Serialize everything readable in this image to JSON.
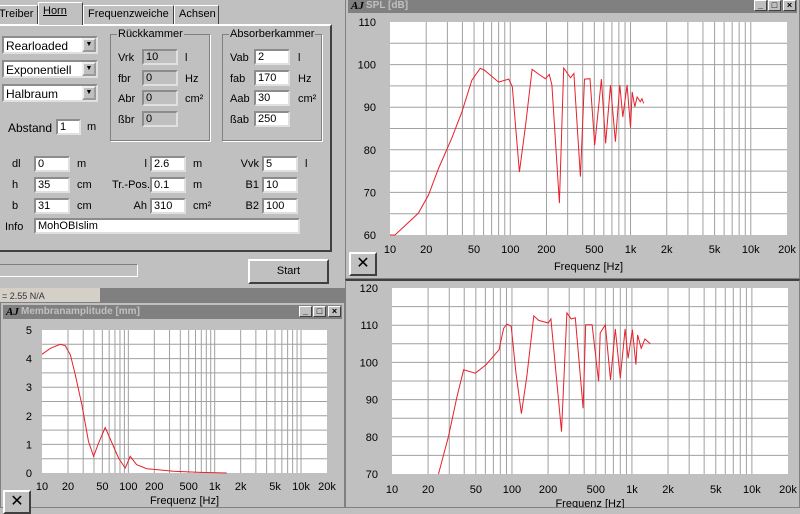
{
  "tabs": [
    "Treiber",
    "Horn",
    "Frequenzweiche",
    "Achsen"
  ],
  "combos": [
    "Rearloaded",
    "Exponentiell",
    "Halbraum"
  ],
  "abstand": {
    "label": "Abstand",
    "value": "1",
    "unit": "m"
  },
  "rueckkammer": {
    "title": "Rückkammer",
    "rows": [
      {
        "label": "Vrk",
        "value": "10",
        "unit": "l"
      },
      {
        "label": "fbr",
        "value": "0",
        "unit": "Hz"
      },
      {
        "label": "Abr",
        "value": "0",
        "unit": "cm²"
      },
      {
        "label": "ßbr",
        "value": "0",
        "unit": ""
      }
    ]
  },
  "absorberkammer": {
    "title": "Absorberkammer",
    "rows": [
      {
        "label": "Vab",
        "value": "2",
        "unit": "l"
      },
      {
        "label": "fab",
        "value": "170",
        "unit": "Hz"
      },
      {
        "label": "Aab",
        "value": "30",
        "unit": "cm²"
      },
      {
        "label": "ßab",
        "value": "250",
        "unit": ""
      }
    ]
  },
  "horn_params": [
    [
      {
        "label": "dl",
        "value": "0",
        "unit": "m"
      },
      {
        "label": "l",
        "value": "2.6",
        "unit": "m"
      },
      {
        "label": "Vvk",
        "value": "5",
        "unit": "l"
      }
    ],
    [
      {
        "label": "h",
        "value": "35",
        "unit": "cm"
      },
      {
        "label": "Tr.-Pos.",
        "value": "0.1",
        "unit": "m"
      },
      {
        "label": "B1",
        "value": "10",
        "unit": ""
      }
    ],
    [
      {
        "label": "b",
        "value": "31",
        "unit": "cm"
      },
      {
        "label": "Ah",
        "value": "310",
        "unit": "cm²"
      },
      {
        "label": "B2",
        "value": "100",
        "unit": ""
      }
    ]
  ],
  "info": {
    "label": "Info",
    "value": "MohOBIslim"
  },
  "start_label": "Start",
  "status_text": "= 2.55 N/A",
  "windows": {
    "spl": "SPL [dB]",
    "membrane": "Membranamplitude [mm]"
  },
  "colors": {
    "curve": "#e8202a",
    "grid": "#a0a0a0"
  },
  "chart_data": [
    {
      "id": "spl",
      "type": "line",
      "title": "SPL [dB]",
      "xlabel": "Frequenz [Hz]",
      "xscale": "log",
      "xlim": [
        10,
        20000
      ],
      "ylim": [
        60,
        110
      ],
      "ytick_step": 10,
      "ygrid_step": 5,
      "xticks": [
        "10",
        "20",
        "50",
        "100",
        "200",
        "500",
        "1k",
        "2k",
        "5k",
        "10k",
        "20k"
      ],
      "yticks": [
        "60",
        "70",
        "80",
        "90",
        "100",
        "110"
      ],
      "points": [
        [
          10,
          59.5
        ],
        [
          11,
          60
        ],
        [
          17.2,
          65.1
        ],
        [
          20.9,
          69.4
        ],
        [
          25.3,
          75.6
        ],
        [
          32.6,
          82.7
        ],
        [
          39.6,
          88.9
        ],
        [
          47.9,
          96.3
        ],
        [
          56.2,
          99.1
        ],
        [
          60.8,
          98.7
        ],
        [
          80,
          95.9
        ],
        [
          97,
          96.6
        ],
        [
          104,
          94.8
        ],
        [
          119,
          74.8
        ],
        [
          134,
          85.8
        ],
        [
          152,
          98.9
        ],
        [
          173,
          97.7
        ],
        [
          196,
          96.7
        ],
        [
          211,
          97.7
        ],
        [
          222,
          95.2
        ],
        [
          256,
          67.5
        ],
        [
          278,
          99.2
        ],
        [
          317,
          96.9
        ],
        [
          338,
          97.9
        ],
        [
          383,
          73.7
        ],
        [
          414,
          96.6
        ],
        [
          460,
          96.7
        ],
        [
          504,
          81.1
        ],
        [
          572,
          96.6
        ],
        [
          621,
          81.5
        ],
        [
          682,
          95.2
        ],
        [
          749,
          81.9
        ],
        [
          815,
          95.2
        ],
        [
          862,
          87.7
        ],
        [
          937,
          95.2
        ],
        [
          1000,
          85.2
        ],
        [
          1033,
          93.6
        ],
        [
          1086,
          90.1
        ],
        [
          1134,
          92.4
        ],
        [
          1206,
          91.3
        ],
        [
          1245,
          92
        ],
        [
          1285,
          90.9
        ]
      ]
    },
    {
      "id": "spl2",
      "type": "line",
      "title": "",
      "xlabel": "Frequenz [Hz]",
      "xscale": "log",
      "xlim": [
        10,
        20000
      ],
      "ylim": [
        70,
        120
      ],
      "ytick_step": 10,
      "ygrid_step": 5,
      "xticks": [
        "10",
        "20",
        "50",
        "100",
        "200",
        "500",
        "1k",
        "2k",
        "5k",
        "10k",
        "20k"
      ],
      "yticks": [
        "70",
        "80",
        "90",
        "100",
        "110",
        "120"
      ],
      "points": [
        [
          24.4,
          70
        ],
        [
          29.6,
          80.1
        ],
        [
          34.8,
          90.8
        ],
        [
          39.5,
          98
        ],
        [
          49.5,
          97.1
        ],
        [
          61,
          99.4
        ],
        [
          78,
          103.4
        ],
        [
          85.4,
          109.2
        ],
        [
          91,
          110.3
        ],
        [
          98.6,
          109.7
        ],
        [
          108,
          97.1
        ],
        [
          119.9,
          86.2
        ],
        [
          133,
          96.2
        ],
        [
          152,
          112.5
        ],
        [
          167,
          111.3
        ],
        [
          201,
          110.6
        ],
        [
          211,
          111.7
        ],
        [
          259,
          81.4
        ],
        [
          287,
          113.3
        ],
        [
          312,
          111.7
        ],
        [
          337,
          112
        ],
        [
          392,
          87.7
        ],
        [
          412,
          110.1
        ],
        [
          466,
          110.1
        ],
        [
          527,
          94.9
        ],
        [
          544,
          107.9
        ],
        [
          600,
          110.1
        ],
        [
          663,
          95.3
        ],
        [
          727,
          109
        ],
        [
          800,
          95.8
        ],
        [
          877,
          109
        ],
        [
          929,
          101.1
        ],
        [
          1009,
          108.8
        ],
        [
          1080,
          99.4
        ],
        [
          1116,
          107.4
        ],
        [
          1196,
          103.8
        ],
        [
          1283,
          106.3
        ],
        [
          1423,
          105
        ]
      ]
    },
    {
      "id": "membrane",
      "type": "line",
      "title": "Membranamplitude [mm]",
      "xlabel": "Frequenz [Hz]",
      "xscale": "log",
      "xlim": [
        10,
        20000
      ],
      "ylim": [
        0,
        5
      ],
      "ytick_step": 1,
      "ygrid_step": 0.5,
      "xticks": [
        "10",
        "20",
        "50",
        "100",
        "200",
        "500",
        "1k",
        "2k",
        "5k",
        "10k",
        "20k"
      ],
      "yticks": [
        "0",
        "1",
        "2",
        "3",
        "4",
        "5"
      ],
      "points": [
        [
          10,
          4.15
        ],
        [
          12.5,
          4.36
        ],
        [
          16.3,
          4.5
        ],
        [
          18.6,
          4.45
        ],
        [
          21.3,
          4.13
        ],
        [
          24.3,
          3.43
        ],
        [
          29,
          2.38
        ],
        [
          34.6,
          1.1
        ],
        [
          39.6,
          0.58
        ],
        [
          45.2,
          1.05
        ],
        [
          54,
          1.59
        ],
        [
          64.6,
          1.05
        ],
        [
          77.1,
          0.52
        ],
        [
          92,
          0.17
        ],
        [
          105,
          0.58
        ],
        [
          125,
          0.29
        ],
        [
          164,
          0.15
        ],
        [
          214,
          0.12
        ],
        [
          333,
          0.06
        ],
        [
          683,
          0.02
        ],
        [
          1380,
          0
        ]
      ]
    }
  ]
}
